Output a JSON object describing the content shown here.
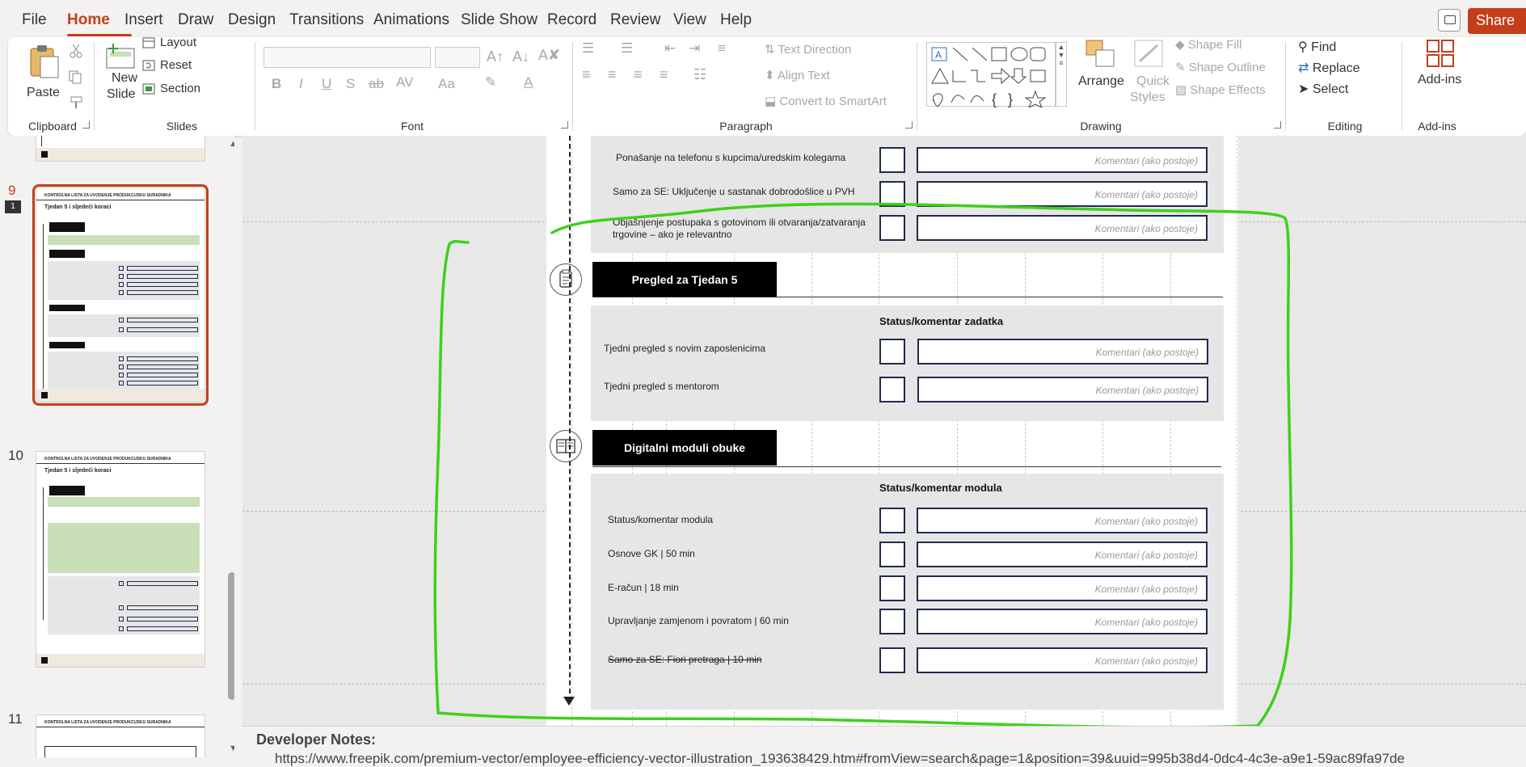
{
  "menu": {
    "tabs": [
      "File",
      "Home",
      "Insert",
      "Draw",
      "Design",
      "Transitions",
      "Animations",
      "Slide Show",
      "Record",
      "Review",
      "View",
      "Help"
    ],
    "active": "Home",
    "share_label": "Share"
  },
  "ribbon": {
    "clipboard": {
      "paste": "Paste",
      "group": "Clipboard"
    },
    "slides": {
      "new_slide_1": "New",
      "new_slide_2": "Slide",
      "layout": "Layout",
      "reset": "Reset",
      "section": "Section",
      "group": "Slides"
    },
    "font": {
      "group": "Font"
    },
    "paragraph": {
      "text_direction": "Text Direction",
      "align_text": "Align Text",
      "convert_smartart": "Convert to SmartArt",
      "group": "Paragraph"
    },
    "drawing": {
      "arrange": "Arrange",
      "quick_styles_1": "Quick",
      "quick_styles_2": "Styles",
      "shape_fill": "Shape Fill",
      "shape_outline": "Shape Outline",
      "shape_effects": "Shape Effects",
      "group": "Drawing"
    },
    "editing": {
      "find": "Find",
      "replace": "Replace",
      "select": "Select",
      "group": "Editing"
    },
    "addins": {
      "addins": "Add-ins",
      "group": "Add-ins"
    }
  },
  "thumbnails": [
    {
      "number": "9",
      "selected": true,
      "comment_count": "1",
      "header": "KONTROLNA LISTA ZA UVODENJE PRODUKCIJSKU SURADNIKA",
      "title": "Tjedan 5 i sljedeći koraci"
    },
    {
      "number": "10",
      "selected": false,
      "header": "KONTROLNA LISTA ZA UVODENJE PRODUKCIJSKU SURADNIKA",
      "title": "Tjedan 5 i sljedeći koraci"
    },
    {
      "number": "11",
      "selected": false,
      "header": "KONTROLNA LISTA ZA UVODENJE PRODUKCIJSKU SURADNIKA"
    }
  ],
  "slide": {
    "top_rows": [
      {
        "label": "Ponašanje na telefonu s kupcima/uredskim kolegama",
        "comment": "Komentari (ako postoje)"
      },
      {
        "label": "Samo za SE: Uključenje u sastanak dobrodošlice u PVH",
        "comment": "Komentari (ako postoje)"
      },
      {
        "label": "Objašnjenje postupaka s gotovinom ili otvaranja/zatvaranja trgovine – ako je relevantno",
        "comment": "Komentari (ako postoje)"
      }
    ],
    "section1": {
      "title": "Pregled za Tjedan 5",
      "status_head": "Status/komentar zadatka",
      "rows": [
        {
          "label": "Tjedni pregled s novim zaposlenicima",
          "comment": "Komentari (ako postoje)"
        },
        {
          "label": "Tjedni pregled s mentorom",
          "comment": "Komentari (ako postoje)"
        }
      ]
    },
    "section2": {
      "title": "Digitalni moduli obuke",
      "status_head": "Status/komentar modula",
      "rows": [
        {
          "label": "Status/komentar modula",
          "comment": "Komentari (ako postoje)"
        },
        {
          "label": "Osnove GK | 50 min",
          "comment": "Komentari (ako postoje)"
        },
        {
          "label": "E-račun | 18 min",
          "comment": "Komentari (ako postoje)"
        },
        {
          "label": "Upravljanje zamjenom i povratom | 60 min",
          "comment": "Komentari (ako postoje)"
        },
        {
          "label": "Samo za SE: Fiori pretraga | 10 min",
          "comment": "Komentari (ako postoje)"
        }
      ]
    }
  },
  "notes": {
    "title": "Developer Notes:",
    "text": "https://www.freepik.com/premium-vector/employee-efficiency-vector-illustration_193638429.htm#fromView=search&page=1&position=39&uuid=995b38d4-0dc4-4c3e-a9e1-59ac89fa97de"
  },
  "colors": {
    "accent": "#c43e1c",
    "annotation": "#3ed01c",
    "box_border": "#1f2b4d",
    "panel": "#e6e6e6"
  }
}
